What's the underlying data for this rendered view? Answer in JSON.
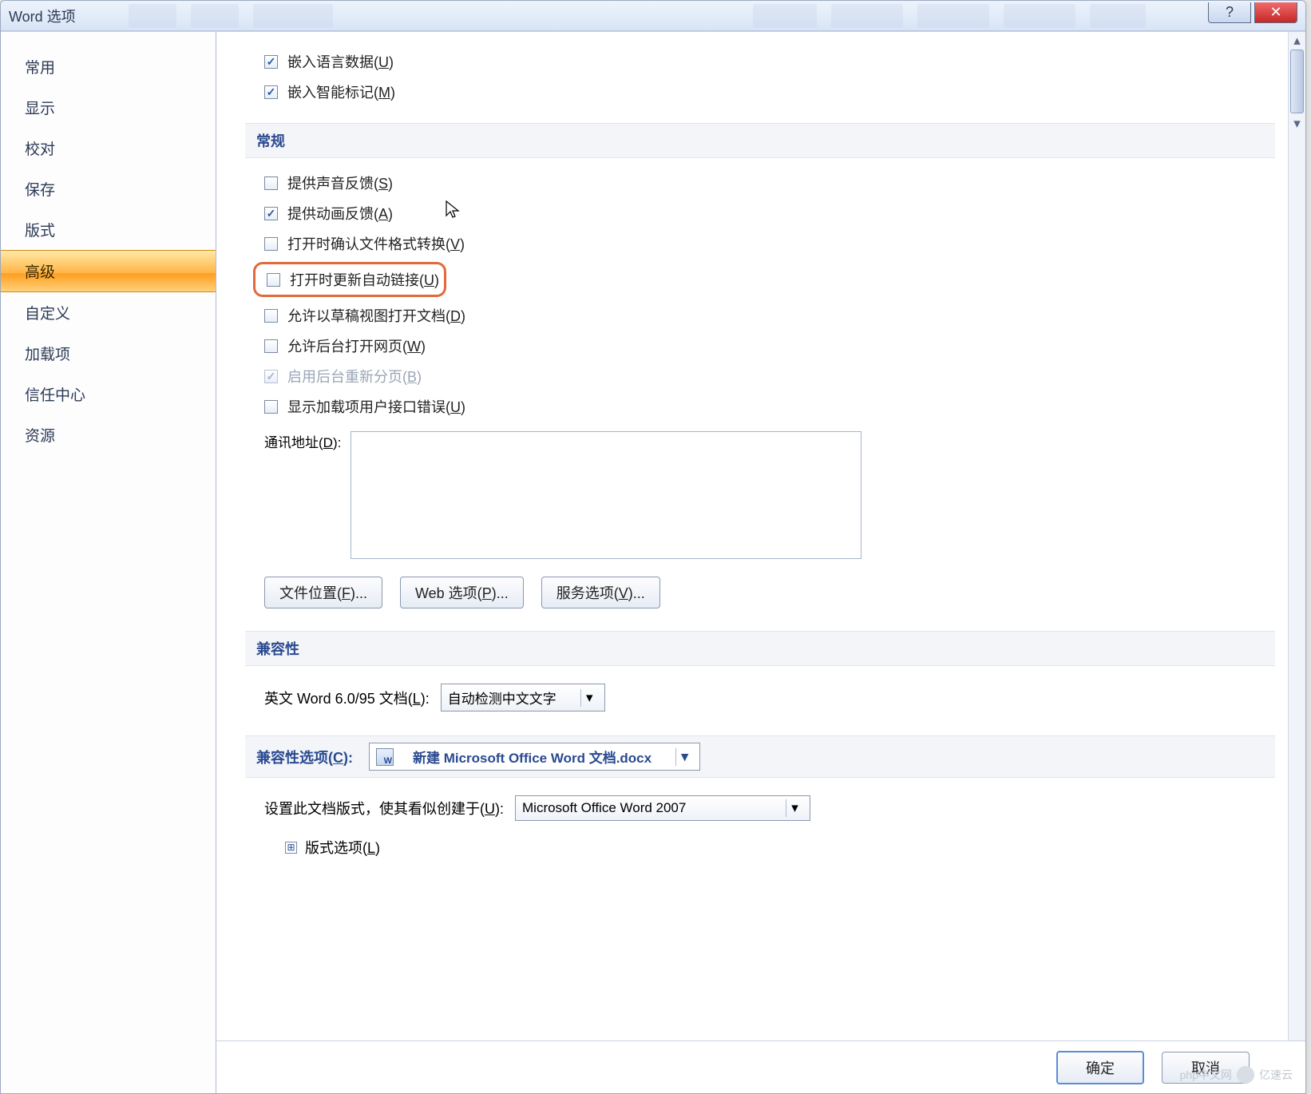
{
  "window": {
    "title": "Word 选项",
    "help_glyph": "?",
    "close_glyph": "✕"
  },
  "sidebar": {
    "items": [
      {
        "label": "常用"
      },
      {
        "label": "显示"
      },
      {
        "label": "校对"
      },
      {
        "label": "保存"
      },
      {
        "label": "版式"
      },
      {
        "label": "高级",
        "selected": true
      },
      {
        "label": "自定义"
      },
      {
        "label": "加载项"
      },
      {
        "label": "信任中心"
      },
      {
        "label": "资源"
      }
    ]
  },
  "content": {
    "top_checks": [
      {
        "checked": true,
        "label": "嵌入语言数据(",
        "accel": "U",
        "tail": ")"
      },
      {
        "checked": true,
        "label": "嵌入智能标记(",
        "accel": "M",
        "tail": ")"
      }
    ],
    "section_general": "常规",
    "general_checks": [
      {
        "checked": false,
        "label": "提供声音反馈(",
        "accel": "S",
        "tail": ")"
      },
      {
        "checked": true,
        "label": "提供动画反馈(",
        "accel": "A",
        "tail": ")",
        "has_cursor": true
      },
      {
        "checked": false,
        "label": "打开时确认文件格式转换(",
        "accel": "V",
        "tail": ")"
      },
      {
        "checked": false,
        "label": "打开时更新自动链接(",
        "accel": "U",
        "tail": ")",
        "highlighted": true
      },
      {
        "checked": false,
        "label": "允许以草稿视图打开文档(",
        "accel": "D",
        "tail": ")"
      },
      {
        "checked": false,
        "label": "允许后台打开网页(",
        "accel": "W",
        "tail": ")"
      },
      {
        "checked": true,
        "label": "启用后台重新分页(",
        "accel": "B",
        "tail": ")",
        "disabled": true
      },
      {
        "checked": false,
        "label": "显示加载项用户接口错误(",
        "accel": "U",
        "tail": ")"
      }
    ],
    "mail_address": {
      "label": "通讯地址(",
      "accel": "D",
      "tail": "):",
      "value": ""
    },
    "buttons_row": [
      {
        "label": "文件位置(",
        "accel": "F",
        "tail": ")..."
      },
      {
        "label": "Web 选项(",
        "accel": "P",
        "tail": ")..."
      },
      {
        "label": "服务选项(",
        "accel": "V",
        "tail": ")..."
      }
    ],
    "section_compat": "兼容性",
    "eng_word": {
      "label": "英文 Word 6.0/95 文档(",
      "accel": "L",
      "tail": "):",
      "value": "自动检测中文文字"
    },
    "compat_opt": {
      "label": "兼容性选项(",
      "accel": "C",
      "tail": "):",
      "value": "新建 Microsoft Office Word 文档.docx"
    },
    "doc_ver": {
      "label": "设置此文档版式，使其看似创建于(",
      "accel": "U",
      "tail": "):",
      "value": "Microsoft Office Word 2007"
    },
    "layout_opts": {
      "glyph": "⊞",
      "label": "版式选项(",
      "accel": "L",
      "tail": ")"
    }
  },
  "footer": {
    "ok": "确定",
    "cancel": "取消"
  },
  "watermark": {
    "left": "php中文网",
    "right": "亿速云"
  }
}
